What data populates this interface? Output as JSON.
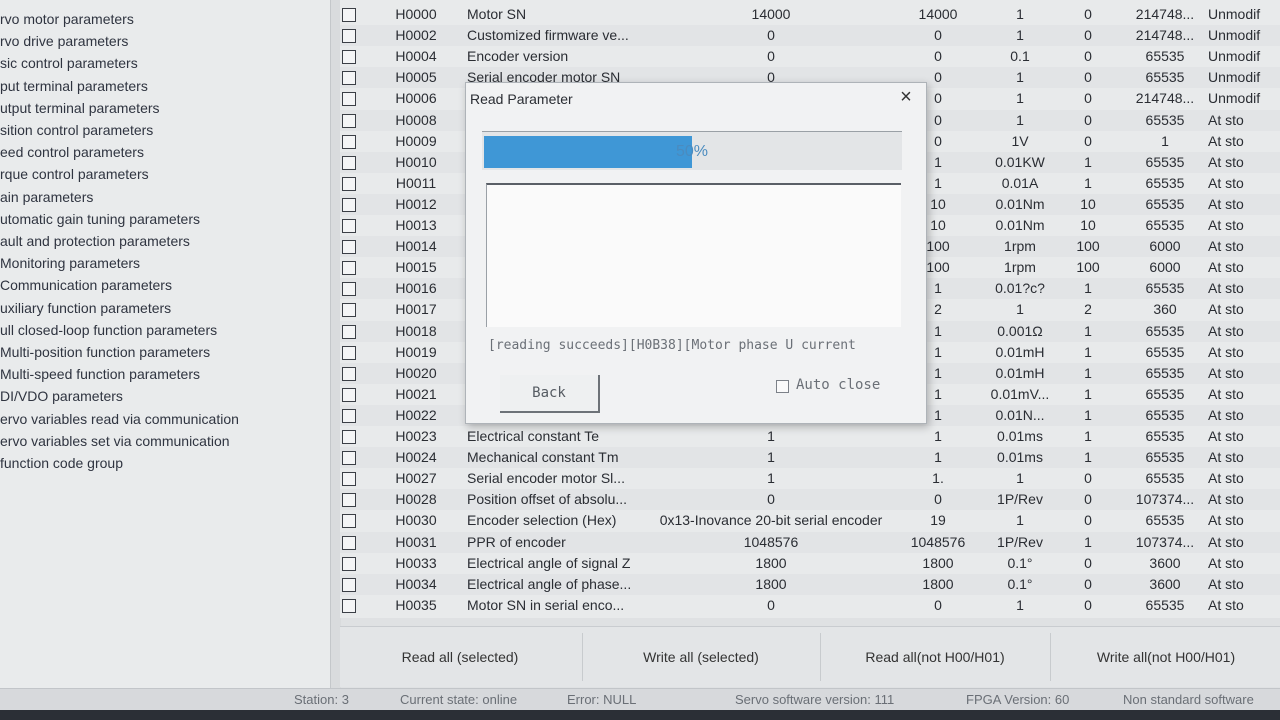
{
  "sidebar": {
    "items": [
      "rvo motor parameters",
      "rvo drive parameters",
      "sic control parameters",
      "put terminal parameters",
      "utput terminal parameters",
      "sition control parameters",
      "eed control parameters",
      "rque control parameters",
      "ain parameters",
      "utomatic gain tuning parameters",
      "ault and protection parameters",
      "Monitoring parameters",
      "Communication parameters",
      "uxiliary function parameters",
      "ull closed-loop function parameters",
      "Multi-position function parameters",
      "Multi-speed function parameters",
      "DI/VDO parameters",
      "ervo variables read via communication",
      "ervo variables set via communication",
      " function code group"
    ]
  },
  "grid": {
    "rows": [
      {
        "code": "H0000",
        "name": "Motor SN",
        "value": "14000",
        "default": "14000",
        "unit": "1",
        "min": "0",
        "max": "214748...",
        "change": "Unmodif"
      },
      {
        "code": "H0002",
        "name": "Customized firmware ve...",
        "value": "0",
        "default": "0",
        "unit": "1",
        "min": "0",
        "max": "214748...",
        "change": "Unmodif"
      },
      {
        "code": "H0004",
        "name": "Encoder version",
        "value": "0",
        "default": "0",
        "unit": "0.1",
        "min": "0",
        "max": "65535",
        "change": "Unmodif"
      },
      {
        "code": "H0005",
        "name": "Serial encoder motor SN",
        "value": "0",
        "default": "0",
        "unit": "1",
        "min": "0",
        "max": "65535",
        "change": "Unmodif"
      },
      {
        "code": "H0006",
        "name": "",
        "value": "",
        "default": "0",
        "unit": "1",
        "min": "0",
        "max": "214748...",
        "change": "Unmodif"
      },
      {
        "code": "H0008",
        "name": "",
        "value": "",
        "default": "0",
        "unit": "1",
        "min": "0",
        "max": "65535",
        "change": "At sto"
      },
      {
        "code": "H0009",
        "name": "",
        "value": "",
        "default": "0",
        "unit": "1V",
        "min": "0",
        "max": "1",
        "change": "At sto"
      },
      {
        "code": "H0010",
        "name": "",
        "value": "",
        "default": "1",
        "unit": "0.01KW",
        "min": "1",
        "max": "65535",
        "change": "At sto"
      },
      {
        "code": "H0011",
        "name": "",
        "value": "",
        "default": "1",
        "unit": "0.01A",
        "min": "1",
        "max": "65535",
        "change": "At sto"
      },
      {
        "code": "H0012",
        "name": "",
        "value": "",
        "default": "10",
        "unit": "0.01Nm",
        "min": "10",
        "max": "65535",
        "change": "At sto"
      },
      {
        "code": "H0013",
        "name": "",
        "value": "",
        "default": "10",
        "unit": "0.01Nm",
        "min": "10",
        "max": "65535",
        "change": "At sto"
      },
      {
        "code": "H0014",
        "name": "",
        "value": "",
        "default": "100",
        "unit": "1rpm",
        "min": "100",
        "max": "6000",
        "change": "At sto"
      },
      {
        "code": "H0015",
        "name": "",
        "value": "",
        "default": "100",
        "unit": "1rpm",
        "min": "100",
        "max": "6000",
        "change": "At sto"
      },
      {
        "code": "H0016",
        "name": "",
        "value": "",
        "default": "1",
        "unit": "0.01?c?",
        "min": "1",
        "max": "65535",
        "change": "At sto"
      },
      {
        "code": "H0017",
        "name": "",
        "value": "",
        "default": "2",
        "unit": "1",
        "min": "2",
        "max": "360",
        "change": "At sto"
      },
      {
        "code": "H0018",
        "name": "",
        "value": "",
        "default": "1",
        "unit": "0.001Ω",
        "min": "1",
        "max": "65535",
        "change": "At sto"
      },
      {
        "code": "H0019",
        "name": "",
        "value": "",
        "default": "1",
        "unit": "0.01mH",
        "min": "1",
        "max": "65535",
        "change": "At sto"
      },
      {
        "code": "H0020",
        "name": "",
        "value": "",
        "default": "1",
        "unit": "0.01mH",
        "min": "1",
        "max": "65535",
        "change": "At sto"
      },
      {
        "code": "H0021",
        "name": "",
        "value": "",
        "default": "1",
        "unit": "0.01mV...",
        "min": "1",
        "max": "65535",
        "change": "At sto"
      },
      {
        "code": "H0022",
        "name": "",
        "value": "",
        "default": "1",
        "unit": "0.01N...",
        "min": "1",
        "max": "65535",
        "change": "At sto"
      },
      {
        "code": "H0023",
        "name": "Electrical constant Te",
        "value": "1",
        "default": "1",
        "unit": "0.01ms",
        "min": "1",
        "max": "65535",
        "change": "At sto"
      },
      {
        "code": "H0024",
        "name": "Mechanical constant Tm",
        "value": "1",
        "default": "1",
        "unit": "0.01ms",
        "min": "1",
        "max": "65535",
        "change": "At sto"
      },
      {
        "code": "H0027",
        "name": "Serial encoder motor Sl...",
        "value": "1",
        "default": "1.",
        "unit": "1",
        "min": "0",
        "max": "65535",
        "change": "At sto"
      },
      {
        "code": "H0028",
        "name": "Position offset of absolu...",
        "value": "0",
        "default": "0",
        "unit": "1P/Rev",
        "min": "0",
        "max": "107374...",
        "change": "At sto"
      },
      {
        "code": "H0030",
        "name": "Encoder selection (Hex)",
        "value": "0x13-Inovance 20-bit serial encoder",
        "default": "19",
        "unit": "1",
        "min": "0",
        "max": "65535",
        "change": "At sto"
      },
      {
        "code": "H0031",
        "name": "PPR of encoder",
        "value": "1048576",
        "default": "1048576",
        "unit": "1P/Rev",
        "min": "1",
        "max": "107374...",
        "change": "At sto"
      },
      {
        "code": "H0033",
        "name": "Electrical angle of signal Z",
        "value": "1800",
        "default": "1800",
        "unit": "0.1°",
        "min": "0",
        "max": "3600",
        "change": "At sto"
      },
      {
        "code": "H0034",
        "name": "Electrical angle of phase...",
        "value": "1800",
        "default": "1800",
        "unit": "0.1°",
        "min": "0",
        "max": "3600",
        "change": "At sto"
      },
      {
        "code": "H0035",
        "name": "Motor SN in serial enco...",
        "value": "0",
        "default": "0",
        "unit": "1",
        "min": "0",
        "max": "65535",
        "change": "At sto"
      }
    ]
  },
  "buttons": {
    "read_selected": "Read all (selected)",
    "write_selected": "Write all (selected)",
    "read_not_h00": "Read all(not H00/H01)",
    "write_not_h00": "Write all(not H00/H01)"
  },
  "status": {
    "station": "Station: 3",
    "state": "Current state: online",
    "error": "Error: NULL",
    "servo_version": "Servo software version: 111",
    "fpga_version": "FPGA Version: 60",
    "nonstandard": "Non standard software"
  },
  "dialog": {
    "title": "Read Parameter",
    "close": "×",
    "progress": 0.5,
    "progress_text": "50%",
    "message": "[reading succeeds][H0B38][Motor phase U current",
    "back_label": "Back",
    "autoclose_label": "Auto close",
    "autoclose_checked": false
  },
  "colors": {
    "progress_fill": "#3f97d6",
    "progress_text": "#4a8bbf"
  }
}
